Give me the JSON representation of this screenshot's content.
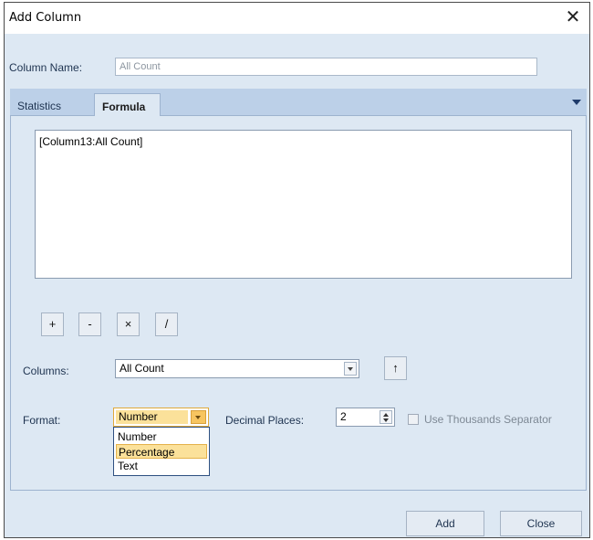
{
  "dialog": {
    "title": "Add Column",
    "close_glyph": "✕"
  },
  "column_name": {
    "label": "Column Name:",
    "value": "All Count"
  },
  "tabs": [
    {
      "label": "Statistics",
      "active": false
    },
    {
      "label": "Formula",
      "active": true
    }
  ],
  "formula": {
    "text": "[Column13:All Count]"
  },
  "operators": [
    "+",
    "-",
    "×",
    "/"
  ],
  "columns": {
    "label": "Columns:",
    "selected": "All Count",
    "insert_glyph": "↑"
  },
  "format": {
    "label": "Format:",
    "selected": "Number",
    "options": [
      "Number",
      "Percentage",
      "Text"
    ],
    "highlighted_option": "Percentage"
  },
  "decimal_places": {
    "label": "Decimal Places:",
    "value": "2"
  },
  "thousands_separator": {
    "label": "Use Thousands Separator",
    "checked": false,
    "enabled": false
  },
  "buttons": {
    "add": "Add",
    "close": "Close"
  },
  "colors": {
    "client_bg": "#dde8f3",
    "tab_strip": "#bcd0e8",
    "highlight": "#fbe19a"
  }
}
